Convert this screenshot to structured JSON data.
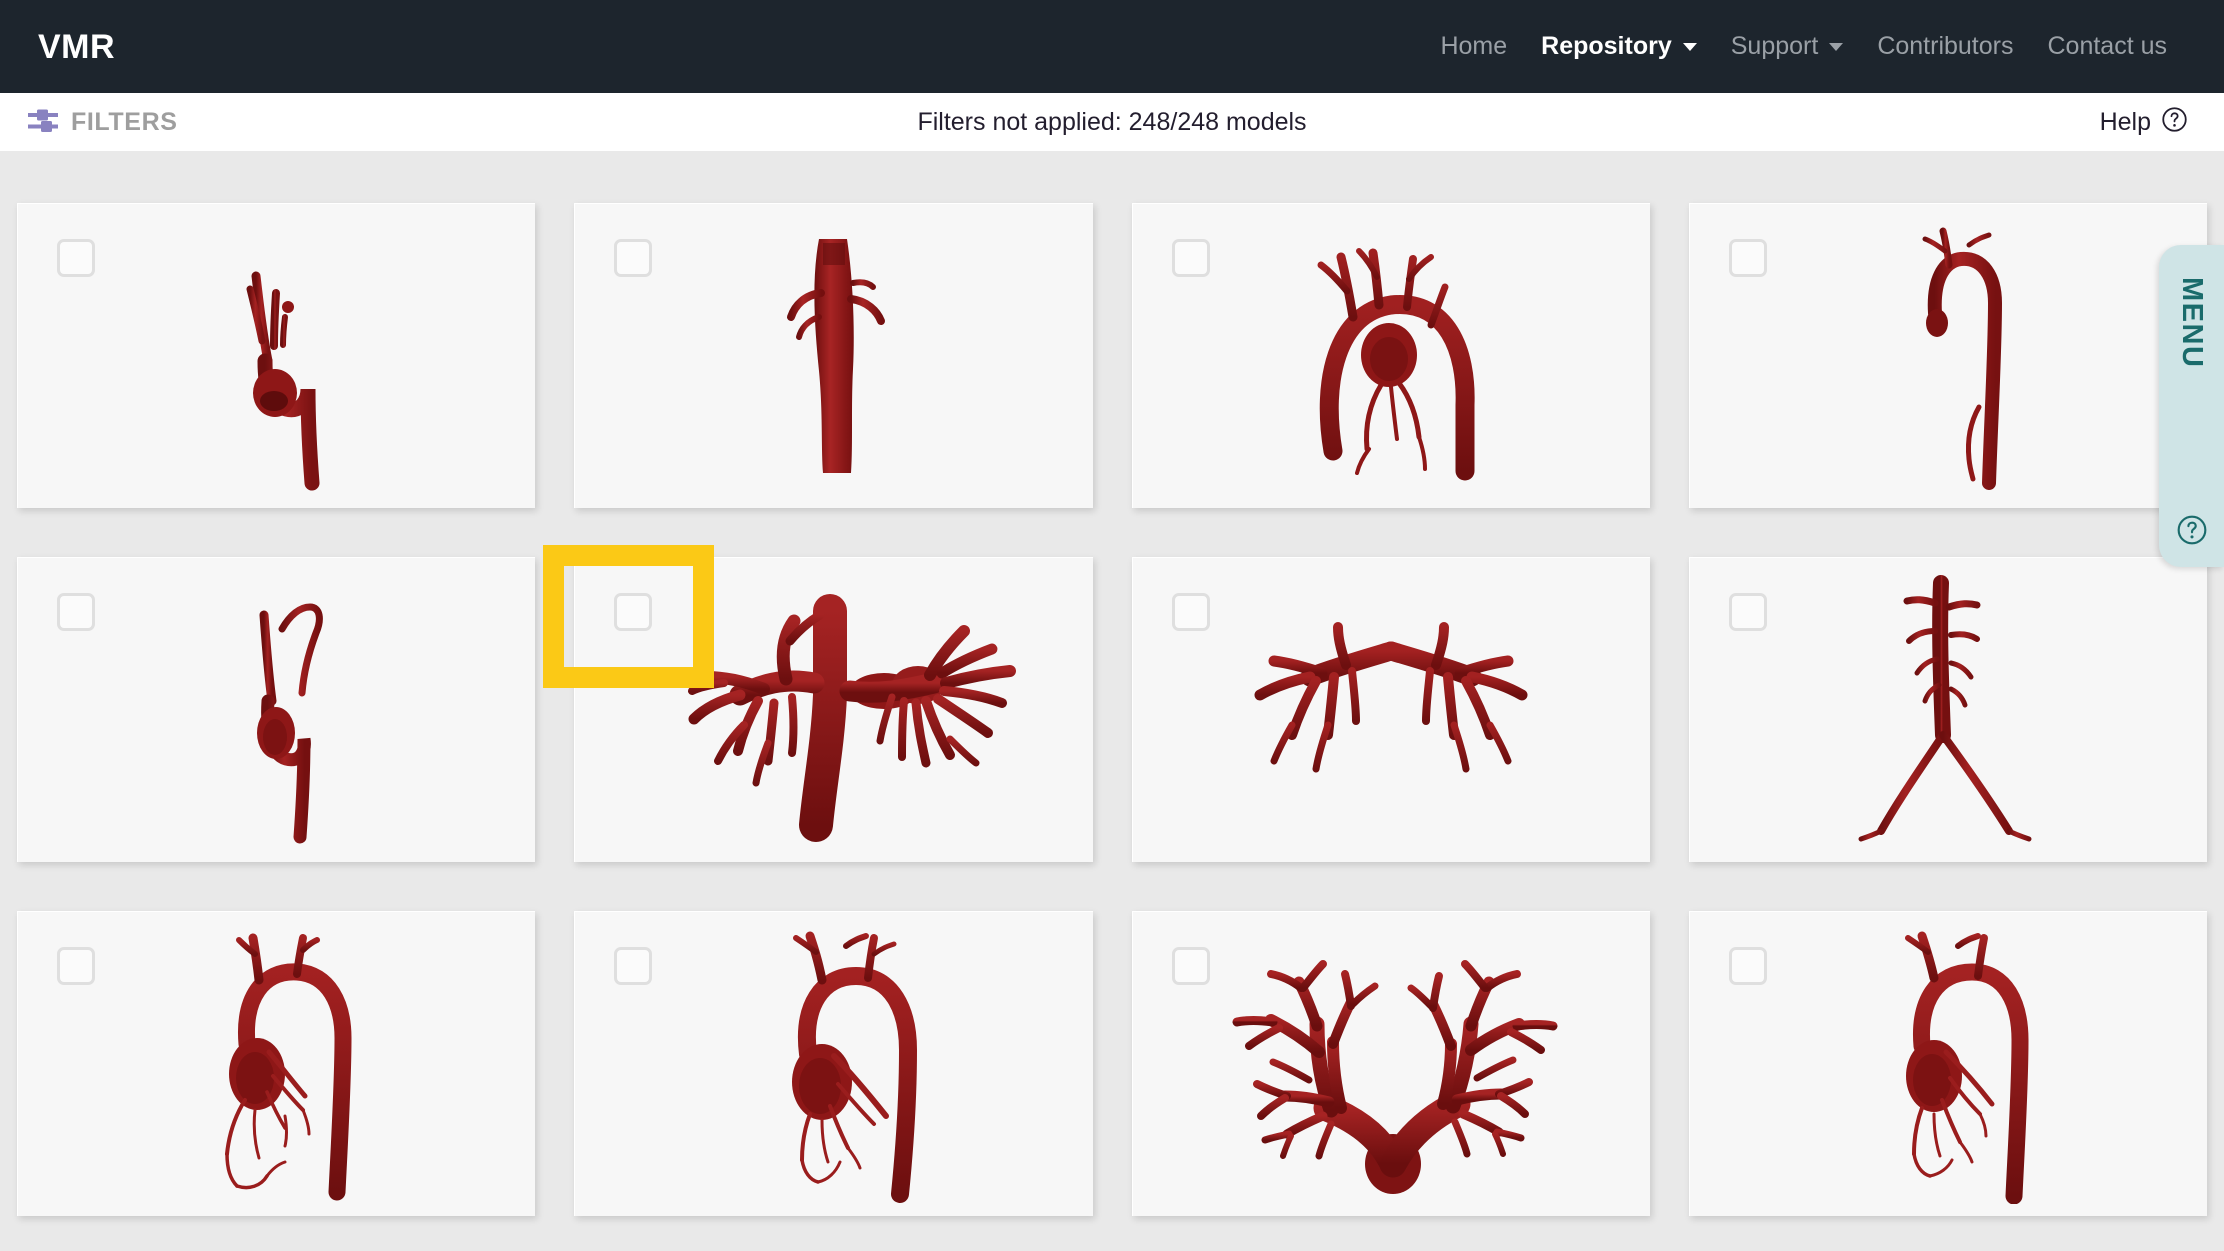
{
  "navbar": {
    "brand": "VMR",
    "links": [
      {
        "label": "Home",
        "active": false,
        "dropdown": false
      },
      {
        "label": "Repository",
        "active": true,
        "dropdown": true
      },
      {
        "label": "Support",
        "active": false,
        "dropdown": true
      },
      {
        "label": "Contributors",
        "active": false,
        "dropdown": false
      },
      {
        "label": "Contact us",
        "active": false,
        "dropdown": false
      }
    ]
  },
  "filterbar": {
    "filters_label": "FILTERS",
    "filters_icon": "sliders-icon",
    "status": "Filters not applied: 248/248 models",
    "help_label": "Help",
    "help_icon": "question-circle-icon"
  },
  "menu_tab": {
    "label": "MENU",
    "help_icon": "question-circle-icon"
  },
  "highlight": {
    "color": "#fbc916",
    "target": "card-6-checkbox"
  },
  "colors": {
    "navbar_bg": "#1d252d",
    "page_bg": "#e9e9e9",
    "card_bg": "#f7f7f7",
    "vessel_red": "#8e1717",
    "vessel_red_dark": "#6d0f0f",
    "vessel_red_light": "#b22a28",
    "accent_teal": "#1a6b6b",
    "menu_tab_bg": "#cfe4e6",
    "filters_purple": "#8982c0",
    "highlight_yellow": "#fbc916"
  },
  "grid": {
    "columns": 4,
    "cards": [
      {
        "id": "card-1",
        "model": "aortic-arch",
        "checked": false,
        "highlighted": false
      },
      {
        "id": "card-2",
        "model": "abdominal-aorta",
        "checked": false,
        "highlighted": false
      },
      {
        "id": "card-3",
        "model": "aortic-arch-branches",
        "checked": false,
        "highlighted": false
      },
      {
        "id": "card-4",
        "model": "thoracic-aorta",
        "checked": false,
        "highlighted": false
      },
      {
        "id": "card-5",
        "model": "aorta-coarctation",
        "checked": false,
        "highlighted": false
      },
      {
        "id": "card-6",
        "model": "pulmonary-artery-tree",
        "checked": false,
        "highlighted": true
      },
      {
        "id": "card-7",
        "model": "pulmonary-bifurcation",
        "checked": false,
        "highlighted": false
      },
      {
        "id": "card-8",
        "model": "aorto-iliac",
        "checked": false,
        "highlighted": false
      },
      {
        "id": "card-9",
        "model": "aorta-coronaries",
        "checked": false,
        "highlighted": false
      },
      {
        "id": "card-10",
        "model": "aorta-pulmonary-shunt",
        "checked": false,
        "highlighted": false
      },
      {
        "id": "card-11",
        "model": "pulmonary-tree-wide",
        "checked": false,
        "highlighted": false
      },
      {
        "id": "card-12",
        "model": "aorta-coronaries-alt",
        "checked": false,
        "highlighted": false
      }
    ]
  }
}
